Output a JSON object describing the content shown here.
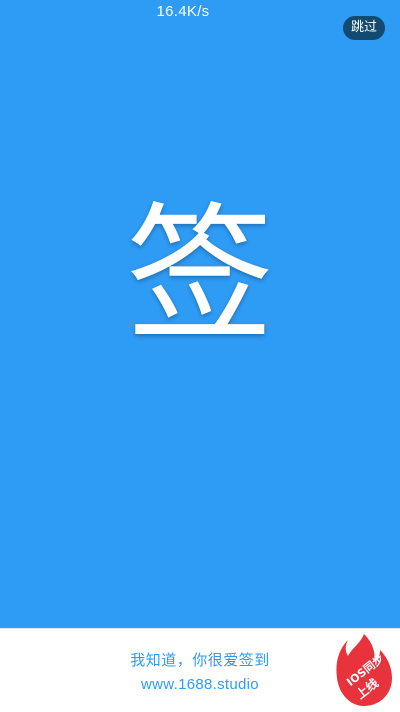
{
  "status_bar": {
    "net_speed": "16.4K/s"
  },
  "splash": {
    "skip_label": "跳过",
    "logo_char": "签",
    "background_color": "#2E9BF5"
  },
  "footer": {
    "slogan": "我知道，你很爱签到",
    "website": "www.1688.studio",
    "badge": {
      "line1": "IOS同步",
      "line2": "上线",
      "color": "#E8323C"
    }
  }
}
